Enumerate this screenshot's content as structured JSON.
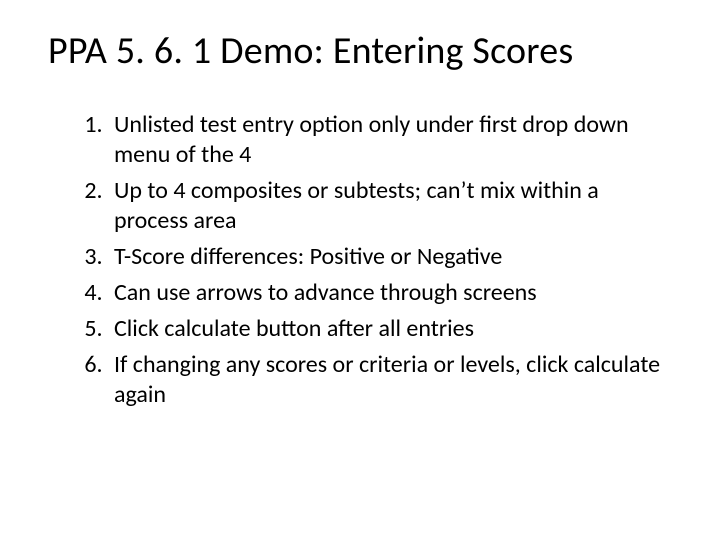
{
  "title": "PPA 5. 6. 1 Demo: Entering Scores",
  "points": [
    "Unlisted test entry option only under first drop down menu of the 4",
    "Up to 4 composites or subtests; can’t mix within a process area",
    "T-Score differences: Positive or Negative",
    "Can use arrows to advance through screens",
    "Click calculate button after all entries",
    "If changing any scores or criteria or levels, click calculate again"
  ]
}
